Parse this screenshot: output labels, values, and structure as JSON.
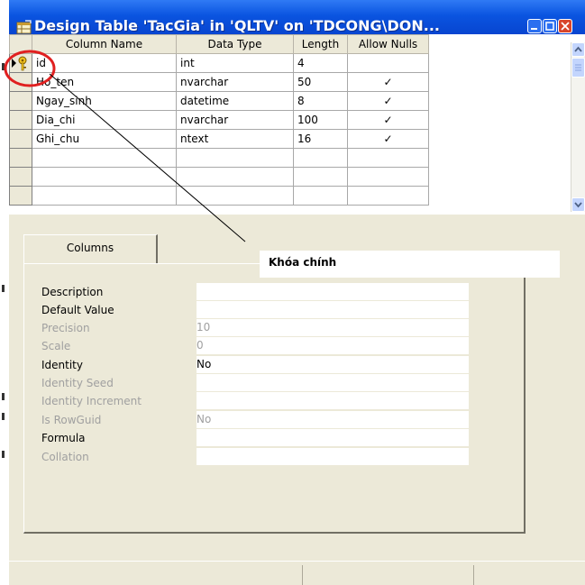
{
  "window": {
    "title": "Design Table 'TacGia' in 'QLTV' on 'TDCONG\\DON...",
    "title_color": "#0a54e0"
  },
  "grid": {
    "headers": [
      "Column Name",
      "Data Type",
      "Length",
      "Allow Nulls"
    ],
    "rows": [
      {
        "name": "id",
        "type": "int",
        "length": "4",
        "nulls": "",
        "primary_key": true
      },
      {
        "name": "Ho_ten",
        "type": "nvarchar",
        "length": "50",
        "nulls": "✓"
      },
      {
        "name": "Ngay_sinh",
        "type": "datetime",
        "length": "8",
        "nulls": "✓"
      },
      {
        "name": "Dia_chi",
        "type": "nvarchar",
        "length": "100",
        "nulls": "✓"
      },
      {
        "name": "Ghi_chu",
        "type": "ntext",
        "length": "16",
        "nulls": "✓"
      }
    ],
    "primary_key_icon": "key-icon",
    "row_pointer_icon": "row-pointer-icon"
  },
  "tabs": {
    "columns_label": "Columns"
  },
  "annotation": {
    "callout_text": "Khóa chính",
    "highlight_color": "#e02020"
  },
  "properties": [
    {
      "label": "Description",
      "value": "",
      "enabled": true
    },
    {
      "label": "Default Value",
      "value": "",
      "enabled": true
    },
    {
      "label": "Precision",
      "value": "10",
      "enabled": false
    },
    {
      "label": "Scale",
      "value": "0",
      "enabled": false
    },
    {
      "label": "Identity",
      "value": "No",
      "enabled": true
    },
    {
      "label": "Identity Seed",
      "value": "",
      "enabled": false
    },
    {
      "label": "Identity Increment",
      "value": "",
      "enabled": false
    },
    {
      "label": "Is RowGuid",
      "value": "No",
      "enabled": false
    },
    {
      "label": "Formula",
      "value": "",
      "enabled": true
    },
    {
      "label": "Collation",
      "value": "",
      "enabled": false
    }
  ]
}
